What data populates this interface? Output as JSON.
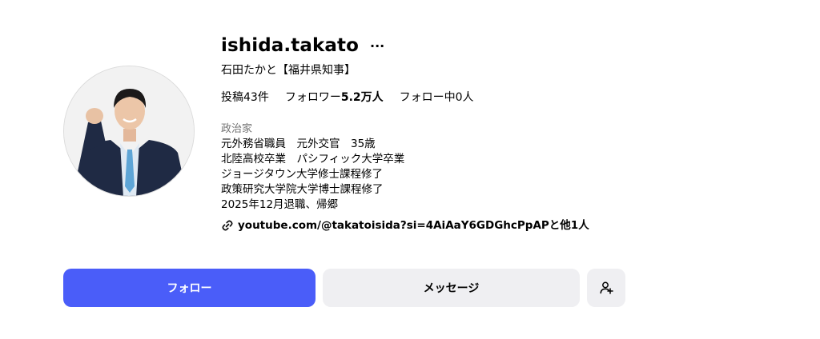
{
  "profile": {
    "username": "ishida.takato",
    "more_icon": "...",
    "full_name": "石田たかと【福井県知事】",
    "stats": {
      "posts_label": "投稿",
      "posts_count": "43件",
      "followers_label": "フォロワー",
      "followers_count": "5.2万人",
      "following_label": "フォロー中",
      "following_count": "0人"
    },
    "category": "政治家",
    "bio_lines": [
      "元外務省職員　元外交官　35歳",
      "北陸高校卒業　パシフィック大学卒業",
      "ジョージタウン大学修士課程修了",
      "政策研究大学院大学博士課程修了",
      "2025年12月退職、帰郷"
    ],
    "link_text": "youtube.com/@takatoisida?si=4AiAaY6GDGhcPpAPと他1人"
  },
  "actions": {
    "follow_label": "フォロー",
    "message_label": "メッセージ",
    "suggest_icon": "add-person-icon"
  },
  "colors": {
    "follow_button": "#4a5df9",
    "secondary_button": "#efeff2",
    "muted_text": "#737373"
  }
}
